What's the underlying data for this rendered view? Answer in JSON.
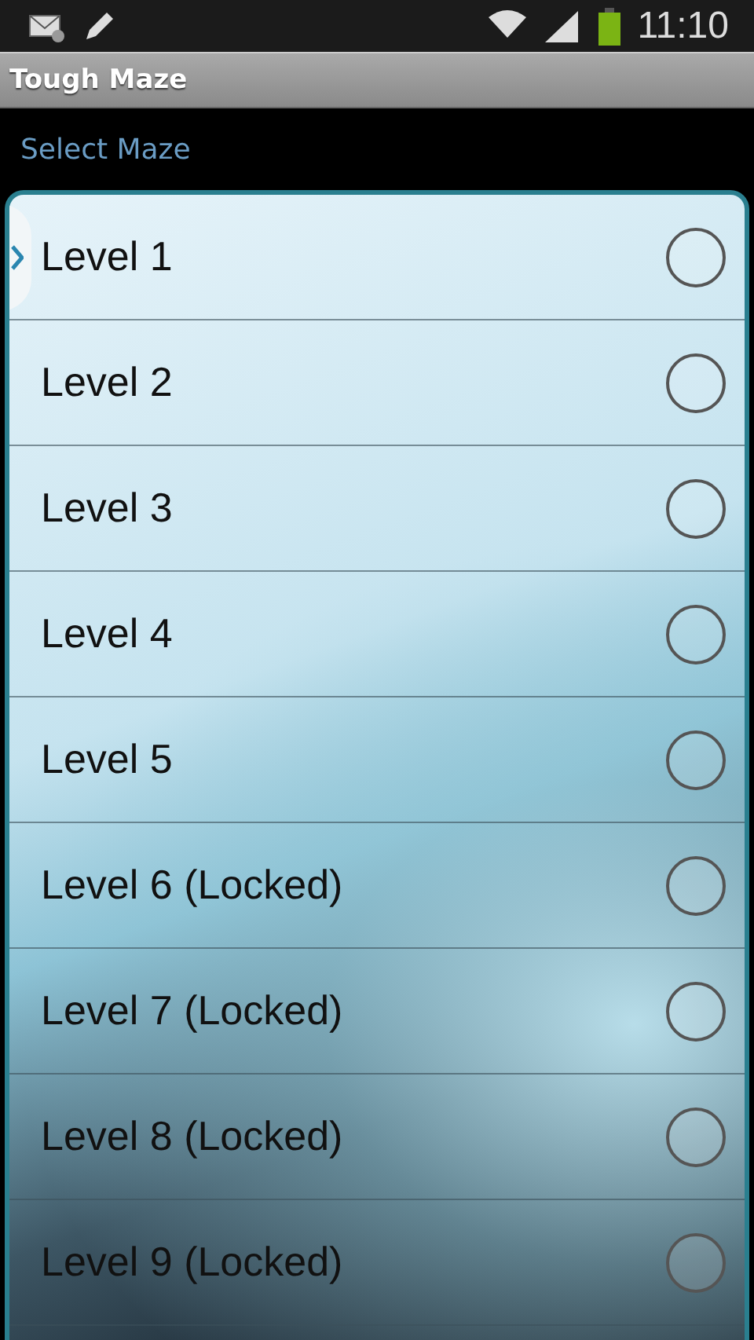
{
  "status_bar": {
    "time": "11:10"
  },
  "window": {
    "title": "Tough Maze"
  },
  "section": {
    "label": "Select Maze"
  },
  "levels": [
    {
      "label": "Level 1",
      "selected": false
    },
    {
      "label": "Level 2",
      "selected": false
    },
    {
      "label": "Level 3",
      "selected": false
    },
    {
      "label": "Level 4",
      "selected": false
    },
    {
      "label": "Level 5",
      "selected": false
    },
    {
      "label": "Level 6 (Locked)",
      "selected": false
    },
    {
      "label": "Level 7 (Locked)",
      "selected": false
    },
    {
      "label": "Level 8 (Locked)",
      "selected": false
    },
    {
      "label": "Level 9 (Locked)",
      "selected": false
    }
  ]
}
